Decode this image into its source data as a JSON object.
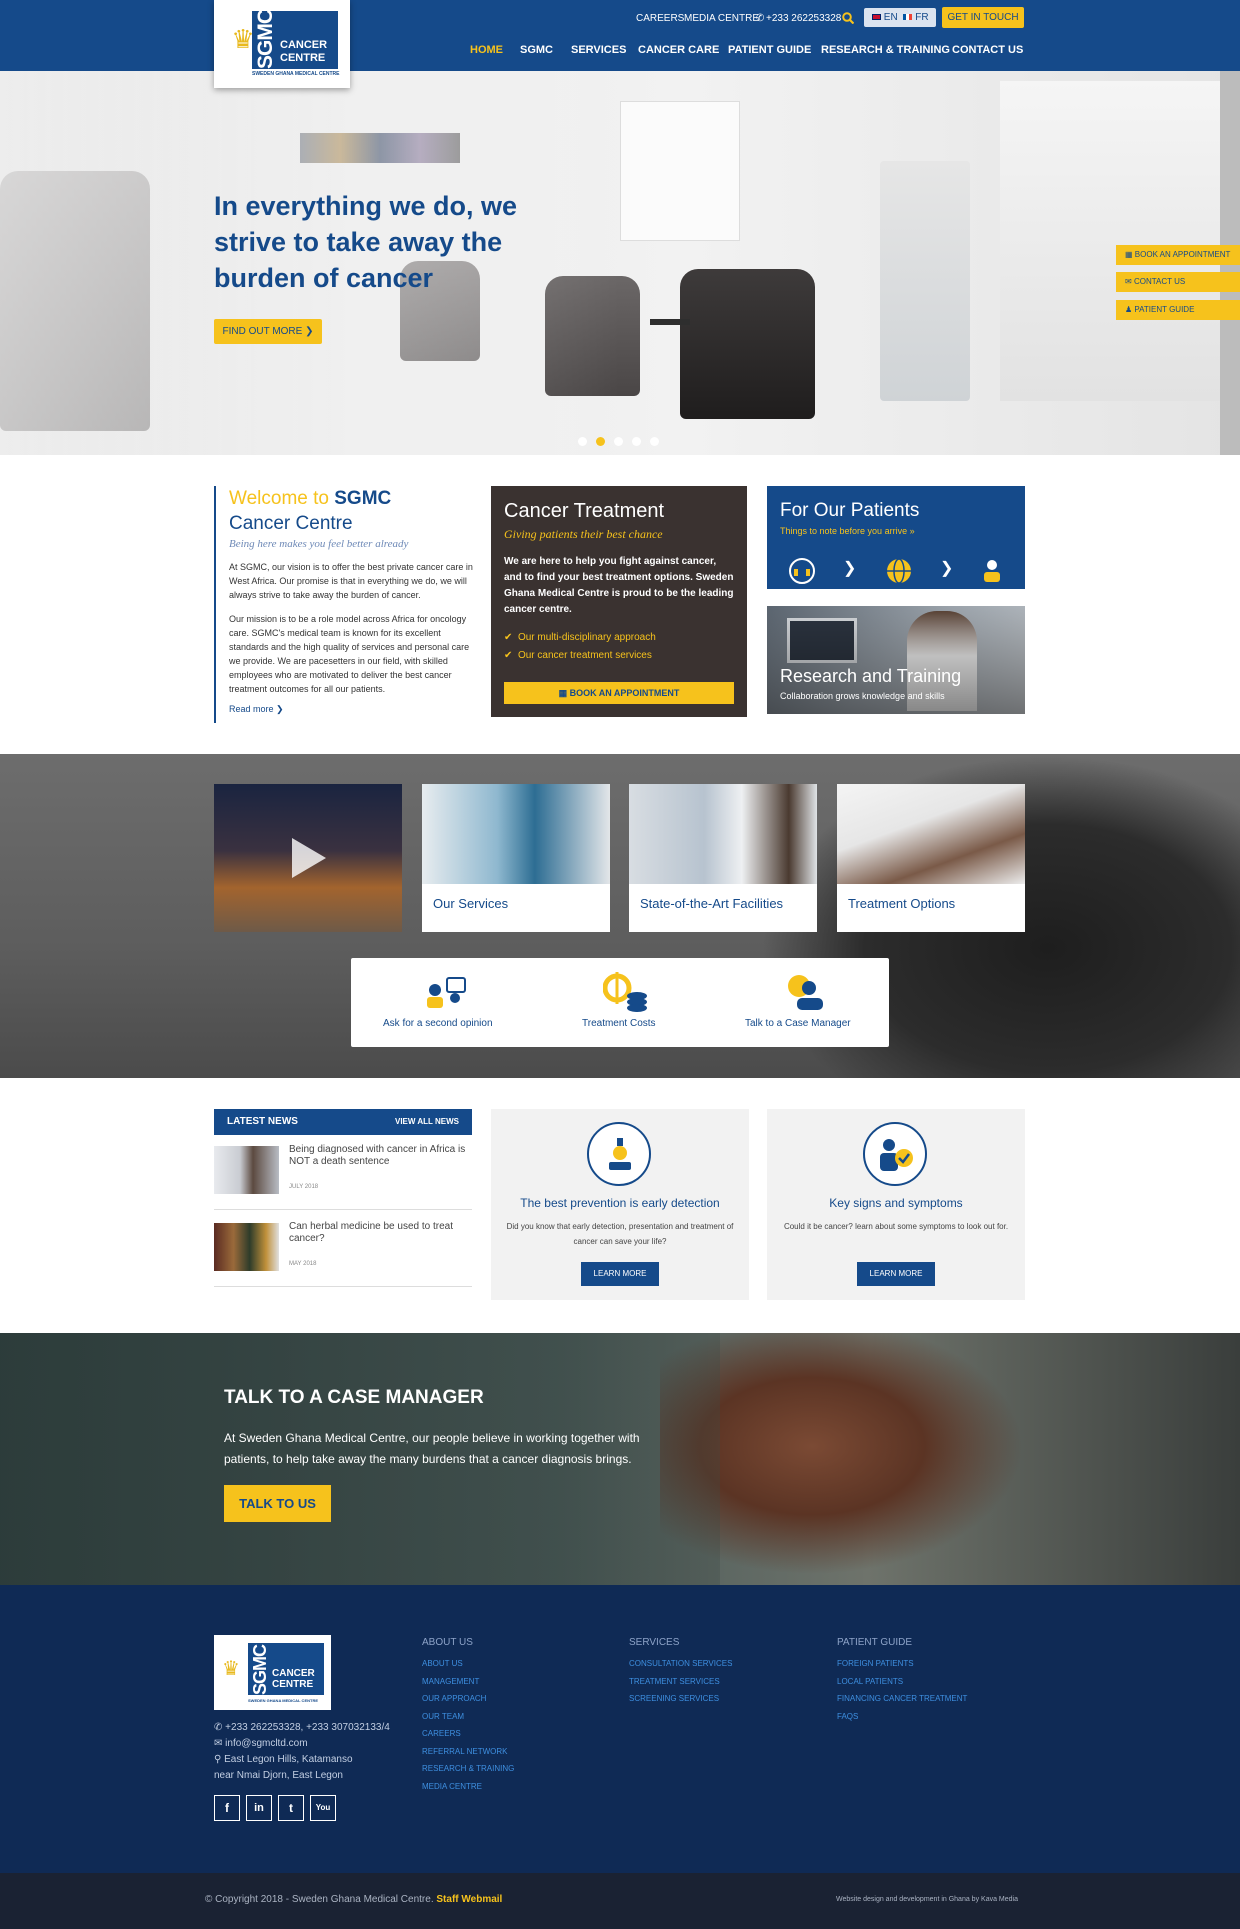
{
  "brand": {
    "logo_text": "SGMC",
    "logo_line1": "CANCER",
    "logo_line2": "CENTRE",
    "logo_sub": "SWEDEN GHANA MEDICAL CENTRE"
  },
  "topbar": {
    "careers": "CAREERS",
    "media": "MEDIA CENTRE",
    "phone": "+233 262253328",
    "lang_en": "EN",
    "lang_fr": "FR",
    "get_in_touch": "GET IN TOUCH"
  },
  "nav": [
    "HOME",
    "SGMC",
    "SERVICES",
    "CANCER CARE",
    "PATIENT GUIDE",
    "RESEARCH & TRAINING",
    "CONTACT US"
  ],
  "hero": {
    "title": "In everything we do, we strive to take away the burden of cancer",
    "button": "FIND OUT MORE",
    "side_tabs": [
      "BOOK AN APPOINTMENT",
      "CONTACT US",
      "PATIENT GUIDE"
    ],
    "slides": 5,
    "active_slide": 2
  },
  "welcome": {
    "title_a": "Welcome to ",
    "title_b": "SGMC",
    "title_c": "Cancer Centre",
    "tagline": "Being here makes you feel better already",
    "p1": "At SGMC, our vision is to offer the best private cancer care in West Africa. Our promise is that in everything we do, we will always strive to take away the burden of cancer.",
    "p2": "Our mission is to be a role model across Africa for oncology care. SGMC's medical team is known for its excellent standards and the high quality of services and personal care we provide. We are pacesetters in our field, with skilled employees who are motivated to deliver the best cancer treatment outcomes for all our patients.",
    "more": "Read more"
  },
  "treatment": {
    "title": "Cancer Treatment",
    "subtitle": "Giving patients their best chance",
    "text": "We are here to help you fight against cancer, and to find your best treatment options. Sweden Ghana Medical Centre is proud to be the leading cancer centre.",
    "items": [
      "Our multi-disciplinary approach",
      "Our cancer treatment services"
    ],
    "button": "BOOK AN APPOINTMENT"
  },
  "patients": {
    "title": "For Our Patients",
    "subtitle": "Things to note before you arrive"
  },
  "research": {
    "title": "Research and Training",
    "subtitle": "Collaboration grows knowledge and skills"
  },
  "cards": [
    "Our Services",
    "State-of-the-Art Facilities",
    "Treatment Options"
  ],
  "quick_links": [
    "Ask for a second opinion",
    "Treatment Costs",
    "Talk to a Case Manager"
  ],
  "news": {
    "heading": "LATEST NEWS",
    "view_all": "VIEW ALL NEWS",
    "items": [
      {
        "title": "Being diagnosed with cancer in Africa is NOT a death sentence",
        "date": "JULY 2018"
      },
      {
        "title": "Can herbal medicine be used to treat cancer?",
        "date": "MAY 2018"
      }
    ]
  },
  "info_boxes": [
    {
      "title": "The best prevention is early detection",
      "text": "Did you know that early detection, presentation and treatment of cancer can save your life?",
      "button": "LEARN MORE",
      "icon": "microscope-icon"
    },
    {
      "title": "Key signs and symptoms",
      "text": "Could it be cancer? learn about some symptoms to look out for.",
      "button": "LEARN MORE",
      "icon": "checklist-person-icon"
    }
  ],
  "case_manager": {
    "title": "TALK TO A CASE MANAGER",
    "text": "At Sweden Ghana Medical Centre, our people believe in working together with patients, to help take away the many burdens that a cancer diagnosis brings.",
    "button": "TALK TO US"
  },
  "footer": {
    "phone": "+233 262253328, +233 307032133/4",
    "email": "info@sgmcltd.com",
    "address1": "East Legon Hills, Katamanso",
    "address2": "near Nmai Djorn, East Legon",
    "columns": [
      {
        "heading": "ABOUT US",
        "links": [
          "ABOUT US",
          "MANAGEMENT",
          "OUR APPROACH",
          "OUR TEAM",
          "CAREERS",
          "REFERRAL NETWORK",
          "RESEARCH & TRAINING",
          "MEDIA CENTRE"
        ]
      },
      {
        "heading": "SERVICES",
        "links": [
          "CONSULTATION SERVICES",
          "TREATMENT SERVICES",
          "SCREENING SERVICES"
        ]
      },
      {
        "heading": "PATIENT GUIDE",
        "links": [
          "FOREIGN PATIENTS",
          "LOCAL PATIENTS",
          "FINANCING CANCER TREATMENT",
          "FAQS"
        ]
      }
    ],
    "social": [
      "f",
      "in",
      "t",
      "You"
    ],
    "copyright": "© Copyright 2018 - Sweden Ghana Medical Centre.",
    "webmail": "Staff Webmail",
    "credit": "Website design and development in Ghana by Kava Media"
  },
  "colors": {
    "primary": "#154a8a",
    "accent": "#f6c21c",
    "dark": "#3a3230",
    "footer": "#0f2a55"
  }
}
